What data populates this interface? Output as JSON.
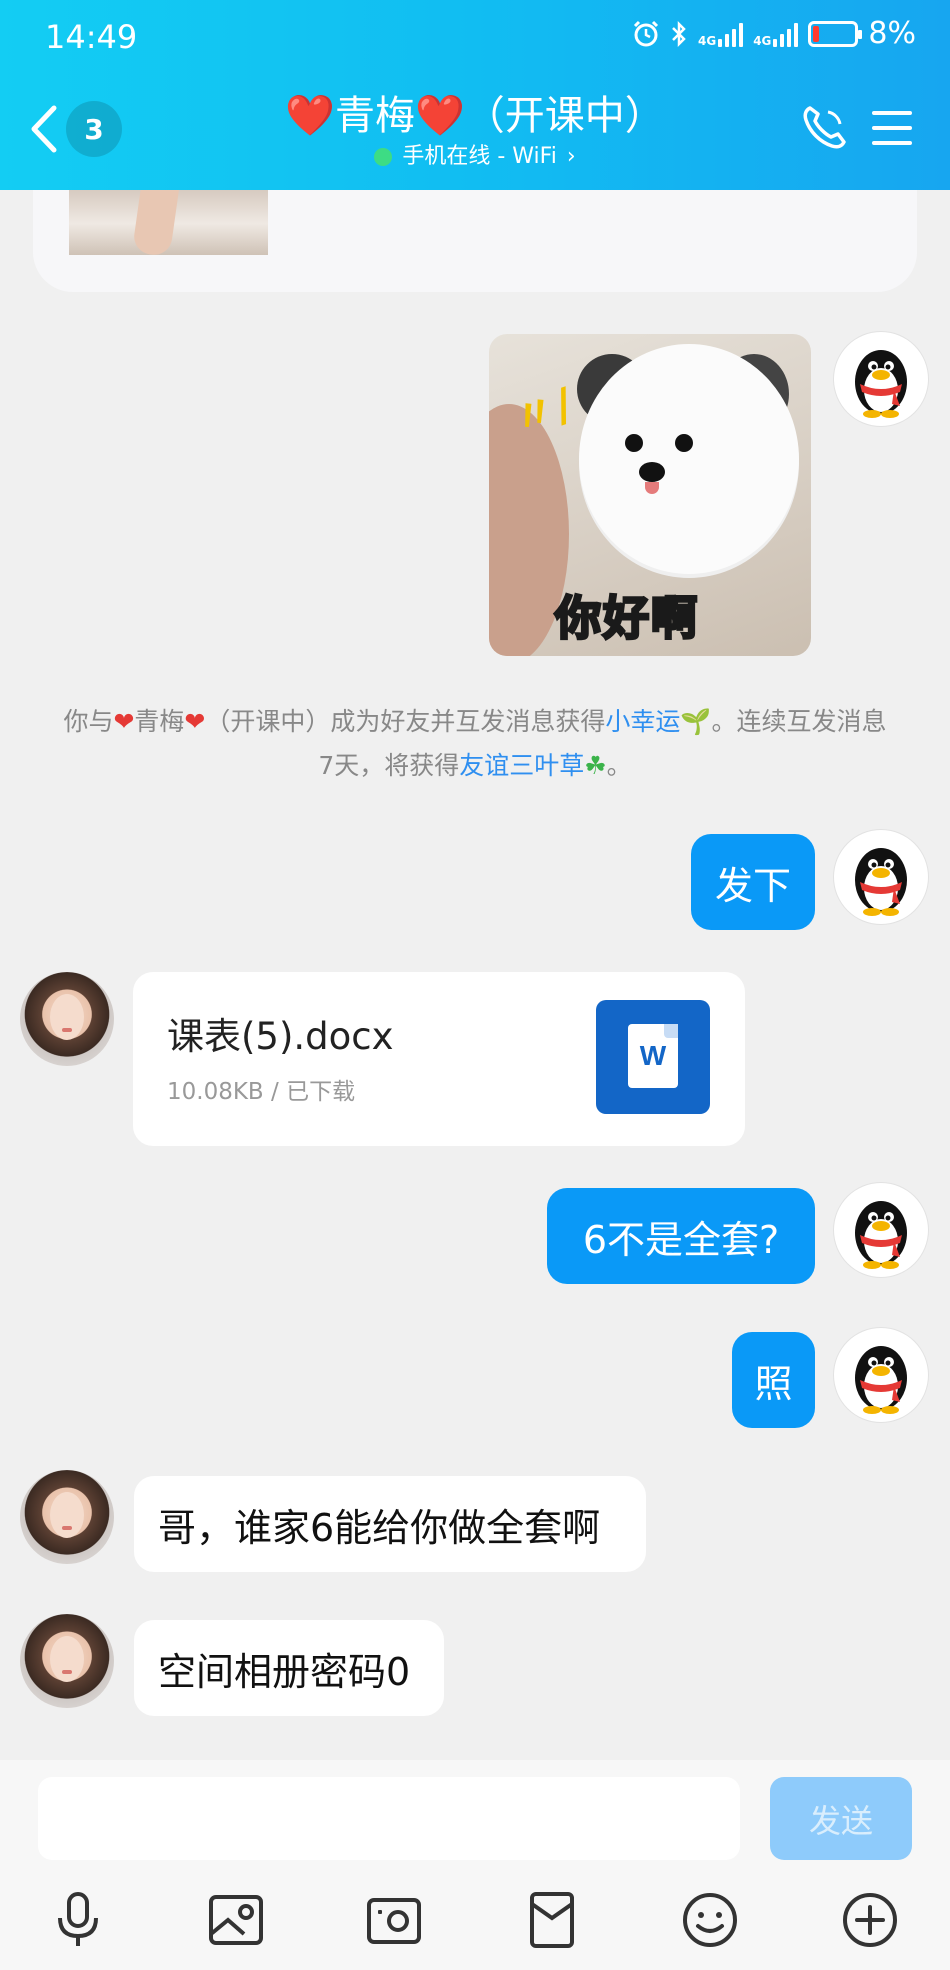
{
  "status_bar": {
    "time": "14:49",
    "network_left": "4G",
    "network_right": "4G",
    "battery": "8%"
  },
  "header": {
    "unread_count": "3",
    "title": "❤️青梅❤️（开课中）",
    "subtitle": "手机在线 - WiFi",
    "subtitle_chevron": "›"
  },
  "messages": {
    "sticker_caption": "你好啊",
    "notice_prefix": "你与",
    "notice_name": "青梅",
    "notice_mid": "（开课中）成为好友并互发消息获得",
    "notice_link1": "小幸运",
    "notice_mid2": "。连续互发消息7天，将获得",
    "notice_link2": "友谊三叶草",
    "notice_end": "。",
    "msg1": "发下",
    "file_name": "课表(5).docx",
    "file_meta": "10.08KB / 已下载",
    "file_icon_letter": "W",
    "msg2": "6不是全套?",
    "msg3": "照",
    "msg4": "哥，谁家6能给你做全套啊",
    "msg5": "空间相册密码0"
  },
  "input": {
    "placeholder": "",
    "send_label": "发送"
  },
  "toolbar": [
    "microphone-icon",
    "image-icon",
    "camera-icon",
    "red-packet-icon",
    "emoji-icon",
    "plus-icon"
  ],
  "colors": {
    "header_start": "#13cdf3",
    "header_end": "#17a6f0",
    "bubble_me": "#0a99f7",
    "link": "#2f8ff0",
    "send_disabled": "#8ecbfb"
  }
}
